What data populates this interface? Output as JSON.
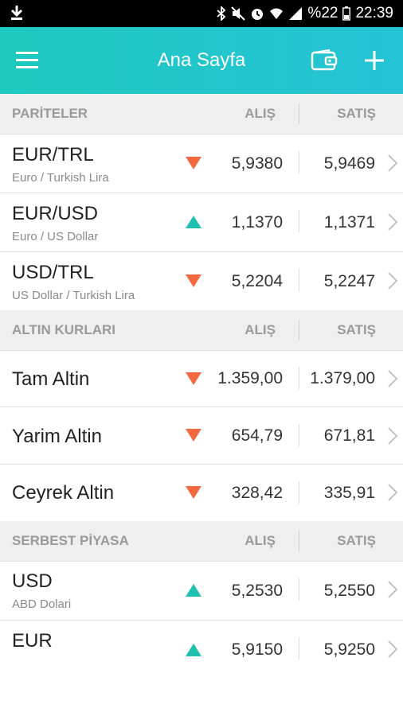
{
  "status": {
    "battery_text": "%22",
    "time": "22:39"
  },
  "header": {
    "title": "Ana Sayfa"
  },
  "colors": {
    "accent": "#1ec9bf",
    "down": "#f4683f",
    "up": "#1ec0b0"
  },
  "sections": [
    {
      "label": "PARİTELER",
      "buy_header": "ALIŞ",
      "sell_header": "SATIŞ",
      "rows": [
        {
          "code": "EUR/TRL",
          "name": "Euro / Turkish Lira",
          "trend": "down",
          "buy": "5,9380",
          "sell": "5,9469"
        },
        {
          "code": "EUR/USD",
          "name": "Euro / US Dollar",
          "trend": "up",
          "buy": "1,1370",
          "sell": "1,1371"
        },
        {
          "code": "USD/TRL",
          "name": "US Dollar / Turkish Lira",
          "trend": "down",
          "buy": "5,2204",
          "sell": "5,2247"
        }
      ]
    },
    {
      "label": "ALTIN KURLARI",
      "buy_header": "ALIŞ",
      "sell_header": "SATIŞ",
      "rows": [
        {
          "code": "Tam Altin",
          "name": "",
          "trend": "down",
          "buy": "1.359,00",
          "sell": "1.379,00"
        },
        {
          "code": "Yarim Altin",
          "name": "",
          "trend": "down",
          "buy": "654,79",
          "sell": "671,81"
        },
        {
          "code": "Ceyrek Altin",
          "name": "",
          "trend": "down",
          "buy": "328,42",
          "sell": "335,91"
        }
      ]
    },
    {
      "label": "SERBEST PİYASA",
      "buy_header": "ALIŞ",
      "sell_header": "SATIŞ",
      "rows": [
        {
          "code": "USD",
          "name": "ABD Dolari",
          "trend": "up",
          "buy": "5,2530",
          "sell": "5,2550"
        },
        {
          "code": "EUR",
          "name": "",
          "trend": "up",
          "buy": "5,9150",
          "sell": "5,9250"
        }
      ]
    }
  ]
}
